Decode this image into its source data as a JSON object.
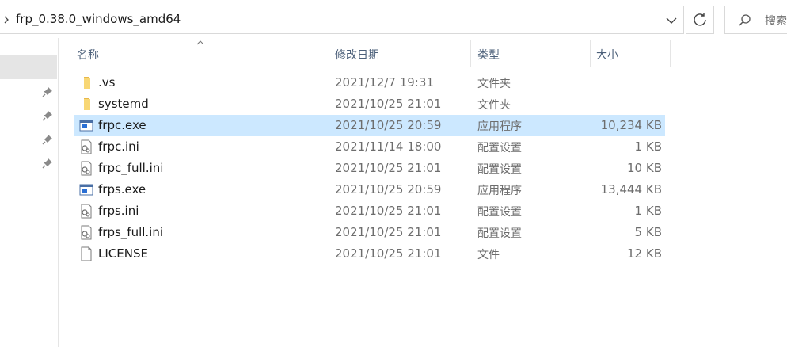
{
  "address": {
    "path": "frp_0.38.0_windows_amd64"
  },
  "search": {
    "placeholder": "搜索"
  },
  "columns": {
    "name": "名称",
    "date": "修改日期",
    "type": "类型",
    "size": "大小"
  },
  "files": [
    {
      "name": ".vs",
      "date": "2021/12/7 19:31",
      "type": "文件夹",
      "size": "",
      "icon": "folder-icon"
    },
    {
      "name": "systemd",
      "date": "2021/10/25 21:01",
      "type": "文件夹",
      "size": "",
      "icon": "folder-icon"
    },
    {
      "name": "frpc.exe",
      "date": "2021/10/25 20:59",
      "type": "应用程序",
      "size": "10,234 KB",
      "icon": "exe-icon"
    },
    {
      "name": "frpc.ini",
      "date": "2021/11/14 18:00",
      "type": "配置设置",
      "size": "1 KB",
      "icon": "ini-icon"
    },
    {
      "name": "frpc_full.ini",
      "date": "2021/10/25 21:01",
      "type": "配置设置",
      "size": "10 KB",
      "icon": "ini-icon"
    },
    {
      "name": "frps.exe",
      "date": "2021/10/25 20:59",
      "type": "应用程序",
      "size": "13,444 KB",
      "icon": "exe-icon"
    },
    {
      "name": "frps.ini",
      "date": "2021/10/25 21:01",
      "type": "配置设置",
      "size": "1 KB",
      "icon": "ini-icon"
    },
    {
      "name": "frps_full.ini",
      "date": "2021/10/25 21:01",
      "type": "配置设置",
      "size": "5 KB",
      "icon": "ini-icon"
    },
    {
      "name": "LICENSE",
      "date": "2021/10/25 21:01",
      "type": "文件",
      "size": "12 KB",
      "icon": "file-icon"
    }
  ],
  "selected_index": 2,
  "colors": {
    "selection": "#cce8ff",
    "header_text": "#4c607a",
    "folder": "#f8d775"
  }
}
